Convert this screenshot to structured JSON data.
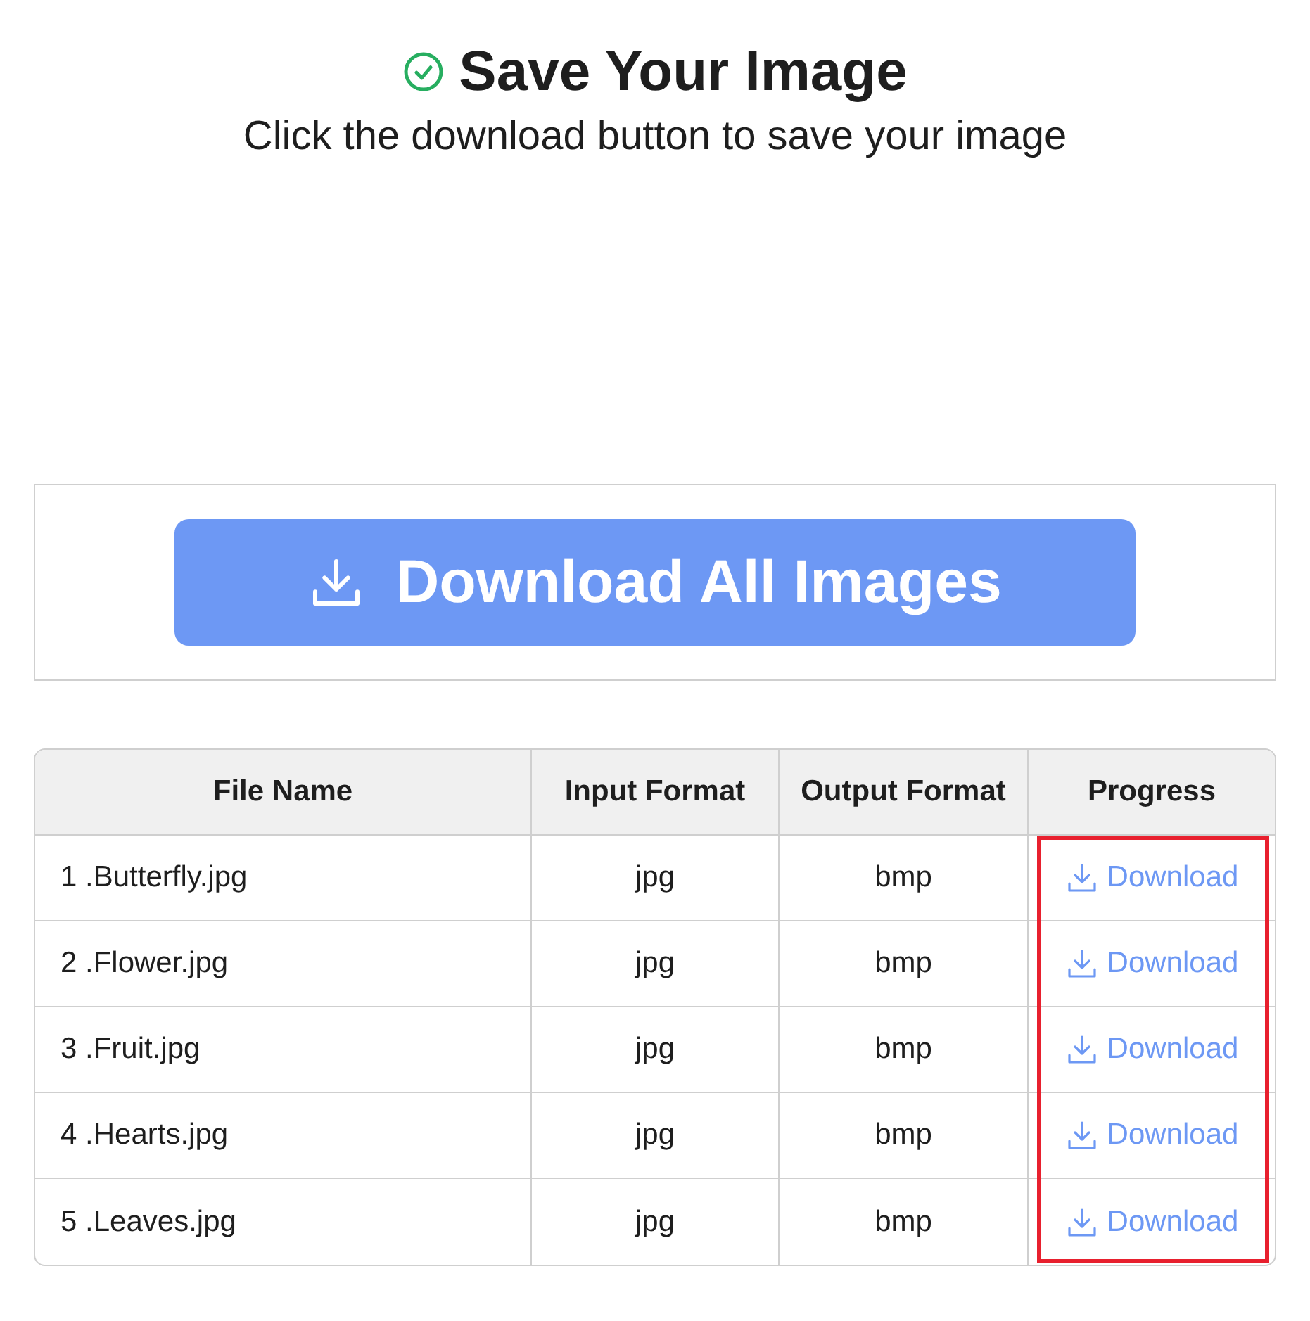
{
  "header": {
    "title": "Save Your Image",
    "subtitle": "Click the download button to save your image"
  },
  "download_all_button": {
    "label": "Download All Images"
  },
  "table": {
    "columns": [
      {
        "label": "File Name",
        "highlighted": false
      },
      {
        "label": "Input Format",
        "highlighted": false
      },
      {
        "label": "Output Format",
        "highlighted": false
      },
      {
        "label": "Progress",
        "highlighted": true
      }
    ],
    "rows": [
      {
        "file_name": "1 .Butterfly.jpg",
        "input_format": "jpg",
        "output_format": "bmp",
        "action": "Download"
      },
      {
        "file_name": "2 .Flower.jpg",
        "input_format": "jpg",
        "output_format": "bmp",
        "action": "Download"
      },
      {
        "file_name": "3 .Fruit.jpg",
        "input_format": "jpg",
        "output_format": "bmp",
        "action": "Download"
      },
      {
        "file_name": "4 .Hearts.jpg",
        "input_format": "jpg",
        "output_format": "bmp",
        "action": "Download"
      },
      {
        "file_name": "5 .Leaves.jpg",
        "input_format": "jpg",
        "output_format": "bmp",
        "action": "Download"
      }
    ]
  }
}
